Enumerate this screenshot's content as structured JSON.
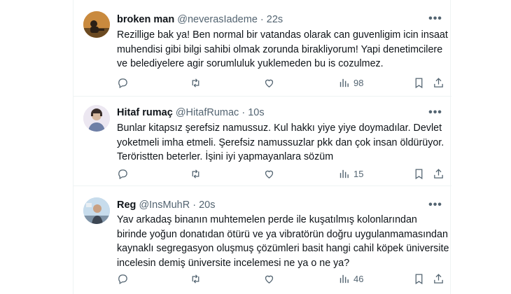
{
  "tweets": [
    {
      "name": "broken man",
      "handle": "@neverasIademe",
      "time": "22s",
      "lines": [
        "Rezillige bak ya! Ben normal bir vatandas olarak can guvenligim icin insaat",
        "muhendisi gibi bilgi sahibi olmak zorunda birakliyorum! Yapi denetimcilere",
        "ve belediyelere agir sorumluluk yuklemeden bu is cozulmez."
      ],
      "views": "98"
    },
    {
      "name": "Hitaf rumaç",
      "handle": "@HitafRumac",
      "time": "10s",
      "lines": [
        "Bunlar kitapsız şerefsiz namussuz. Kul hakkı yiye yiye doymadılar. Devlet",
        "yoketmeli imha etmeli. Şerefsiz namussuzlar pkk dan çok insan öldürüyor.",
        "Teröristten beterler. İşini iyi yapmayanlara sözüm"
      ],
      "views": "15"
    },
    {
      "name": "Reg",
      "handle": "@InsMuhR",
      "time": "20s",
      "lines": [
        "Yav arkadaş binanın muhtemelen perde ile kuşatılmış kolonlarından",
        "birinde yoğun donatıdan ötürü ve ya vibratörün doğru uygulanmamasından",
        "kaynaklı segregasyon oluşmuş çözümleri basit hangi cahil köpek üniversite",
        "incelesin demiş üniversite incelemesi ne ya o ne ya?"
      ],
      "views": "46"
    }
  ],
  "separator": "·",
  "more_glyph": "•••",
  "icons": [
    "reply-icon",
    "retweet-icon",
    "like-icon",
    "views-icon",
    "bookmark-icon",
    "share-icon"
  ],
  "colors": {
    "text": "#0f1419",
    "secondary": "#536471",
    "border": "#eff3f4"
  }
}
